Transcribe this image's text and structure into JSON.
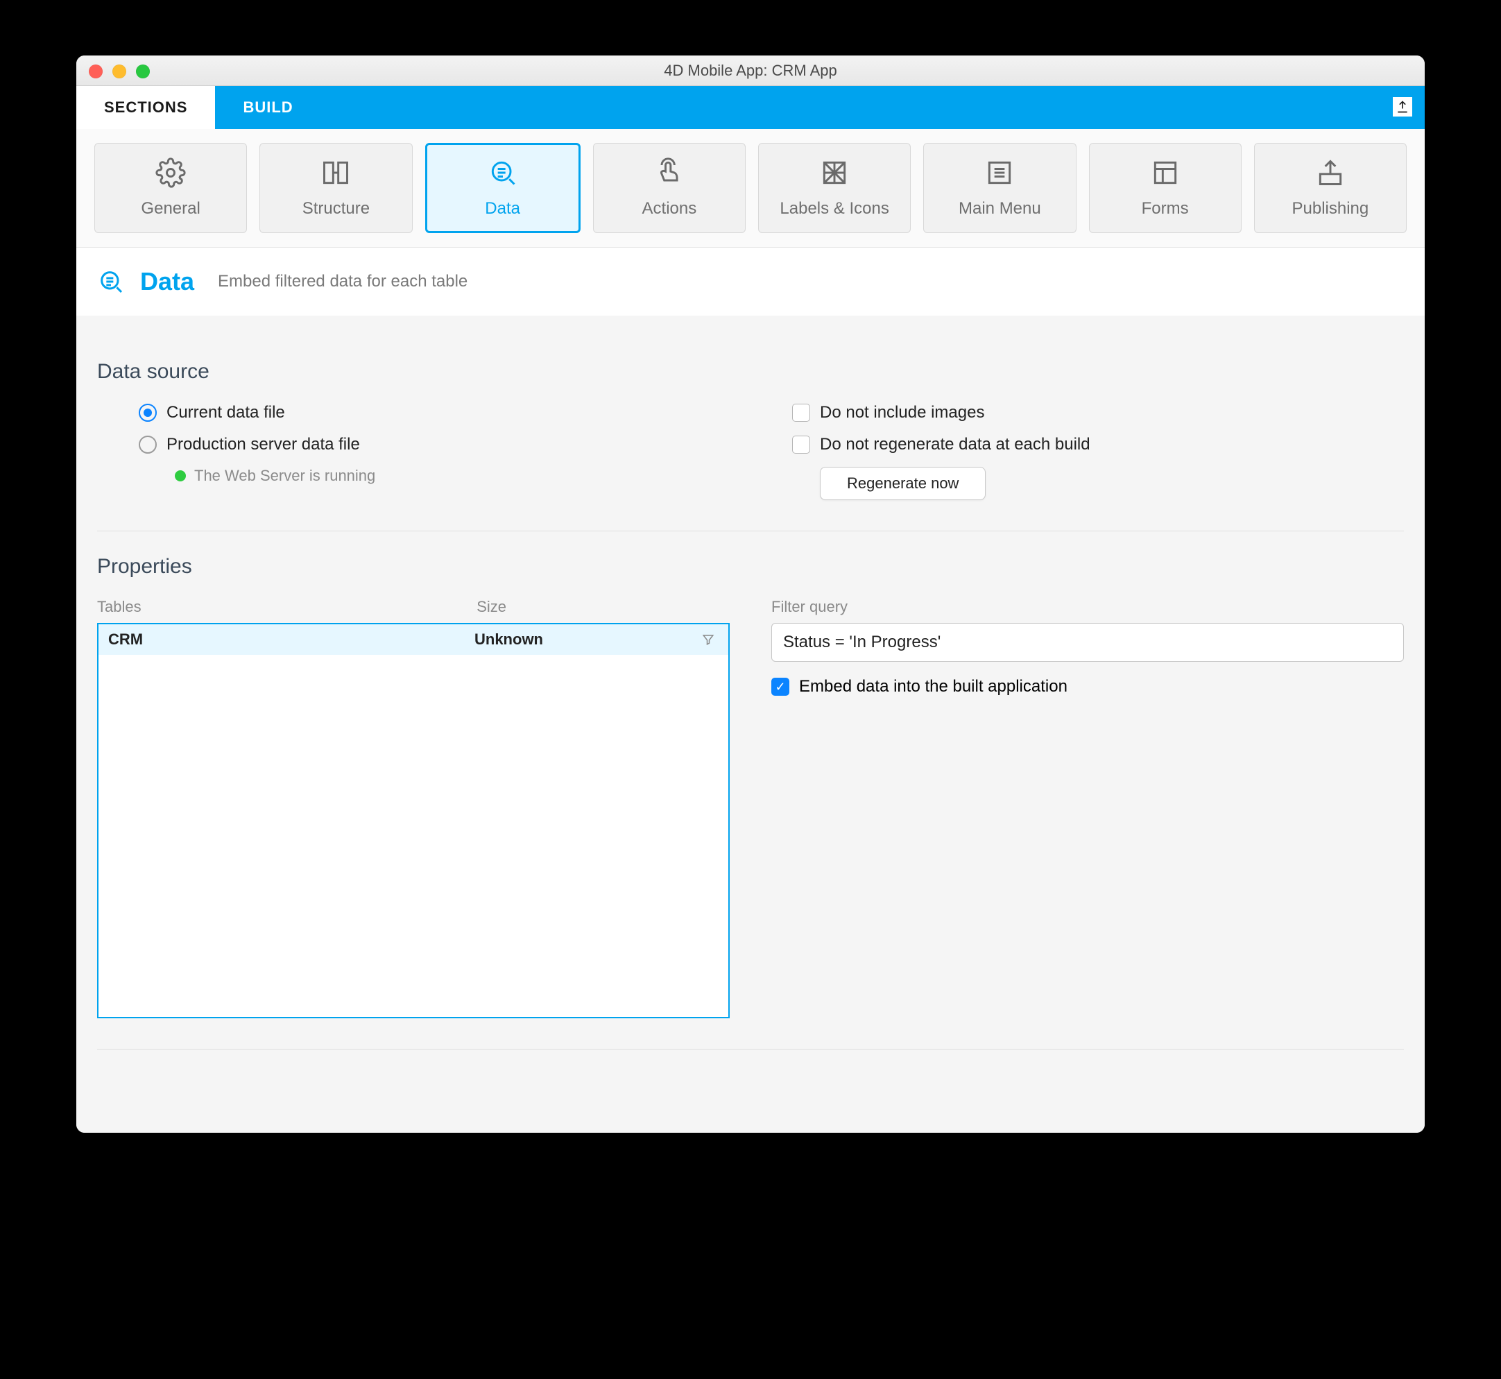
{
  "window": {
    "title": "4D Mobile App: CRM App"
  },
  "tabs": {
    "sections": "SECTIONS",
    "build": "BUILD"
  },
  "toolbar": {
    "general": "General",
    "structure": "Structure",
    "data": "Data",
    "actions": "Actions",
    "labels": "Labels & Icons",
    "mainmenu": "Main Menu",
    "forms": "Forms",
    "publishing": "Publishing"
  },
  "header": {
    "title": "Data",
    "subtitle": "Embed filtered data for each table"
  },
  "datasource": {
    "heading": "Data source",
    "current": "Current data file",
    "production": "Production server data file",
    "server_status": "The Web Server is running",
    "noimages": "Do not include images",
    "noregen": "Do not regenerate data at each build",
    "regen_btn": "Regenerate now"
  },
  "properties": {
    "heading": "Properties",
    "col_tables": "Tables",
    "col_size": "Size",
    "rows": [
      {
        "name": "CRM",
        "size": "Unknown"
      }
    ],
    "filter_label": "Filter query",
    "filter_value": "Status = 'In Progress'",
    "embed_label": "Embed data into the built application"
  }
}
